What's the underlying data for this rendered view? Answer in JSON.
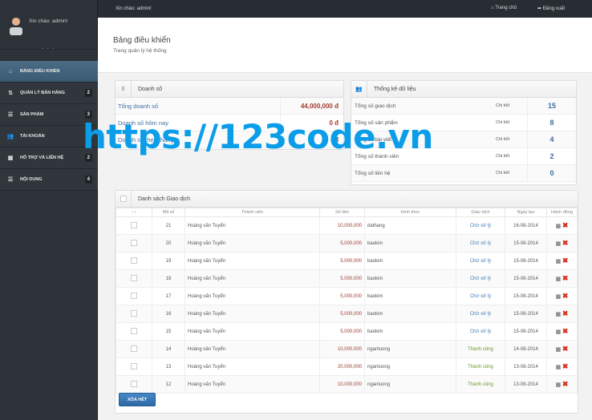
{
  "user": {
    "greeting": "Xin chào: admin!"
  },
  "topbar": {
    "greeting": "Xin chào: admin!",
    "home": "Trang chủ",
    "logout": "Đăng xuất"
  },
  "sidebar": {
    "items": [
      {
        "label": "BẢNG ĐIỀU KHIỂN",
        "icon": "home-icon",
        "badge": null
      },
      {
        "label": "QUẢN LÝ BÁN HÀNG",
        "icon": "sort-icon",
        "badge": "2"
      },
      {
        "label": "SẢN PHẨM",
        "icon": "list-icon",
        "badge": "3"
      },
      {
        "label": "TÀI KHOẢN",
        "icon": "users-icon",
        "badge": null
      },
      {
        "label": "HỖ TRỢ VÀ LIÊN HỆ",
        "icon": "layout-icon",
        "badge": "2"
      },
      {
        "label": "NỘI DUNG",
        "icon": "list-icon",
        "badge": "4"
      }
    ]
  },
  "header": {
    "title": "Bảng điều khiển",
    "subtitle": "Trang quản lý hệ thống"
  },
  "sales": {
    "title": "Doanh số",
    "rows": [
      {
        "label": "Tổng doanh số",
        "value": "44,000,000 đ"
      },
      {
        "label": "Doanh số hôm nay",
        "value": "0 đ"
      },
      {
        "label": "Doanh số theo tháng",
        "value": "đ"
      }
    ]
  },
  "stats": {
    "title": "Thống kê dữ liệu",
    "detail": "Chi tiết",
    "rows": [
      {
        "label": "Tổng số giao dịch",
        "value": "15"
      },
      {
        "label": "Tổng số sản phẩm",
        "value": "8"
      },
      {
        "label": "Tổng số bài viết",
        "value": "4"
      },
      {
        "label": "Tổng số thành viên",
        "value": "2"
      },
      {
        "label": "Tổng số liên hệ",
        "value": "0"
      }
    ]
  },
  "transactions": {
    "title": "Danh sách Giao dịch",
    "columns": [
      "↓↑",
      "Mã số",
      "Thành viên",
      "Số tiền",
      "Hình thức",
      "Giao dịch",
      "Ngày tạo",
      "Hành động"
    ],
    "rows": [
      {
        "id": "21",
        "member": "Hoàng văn Tuyển",
        "amount": "10,000,000",
        "method": "dathang",
        "status": "Chờ xử lý",
        "date": "16-08-2014"
      },
      {
        "id": "20",
        "member": "Hoàng văn Tuyển",
        "amount": "5,000,000",
        "method": "baokim",
        "status": "Chờ xử lý",
        "date": "15-08-2014"
      },
      {
        "id": "19",
        "member": "Hoàng văn Tuyển",
        "amount": "5,000,000",
        "method": "baokim",
        "status": "Chờ xử lý",
        "date": "15-08-2014"
      },
      {
        "id": "18",
        "member": "Hoàng văn Tuyển",
        "amount": "5,000,000",
        "method": "baokim",
        "status": "Chờ xử lý",
        "date": "15-08-2014"
      },
      {
        "id": "17",
        "member": "Hoàng văn Tuyển",
        "amount": "5,000,000",
        "method": "baokim",
        "status": "Chờ xử lý",
        "date": "15-08-2014"
      },
      {
        "id": "16",
        "member": "Hoàng văn Tuyển",
        "amount": "5,000,000",
        "method": "baokim",
        "status": "Chờ xử lý",
        "date": "15-08-2014"
      },
      {
        "id": "15",
        "member": "Hoàng văn Tuyển",
        "amount": "5,000,000",
        "method": "baokim",
        "status": "Chờ xử lý",
        "date": "15-08-2014"
      },
      {
        "id": "14",
        "member": "Hoàng văn Tuyển",
        "amount": "10,000,000",
        "method": "nganluong",
        "status": "Thành công",
        "date": "14-08-2014"
      },
      {
        "id": "13",
        "member": "Hoàng văn Tuyển",
        "amount": "20,000,000",
        "method": "nganluong",
        "status": "Thành công",
        "date": "13-08-2014"
      },
      {
        "id": "12",
        "member": "Hoàng văn Tuyển",
        "amount": "10,000,000",
        "method": "nganluong",
        "status": "Thành công",
        "date": "13-08-2014"
      }
    ],
    "clear_button": "XÓA HẾT"
  },
  "watermark": "https://123code.vn",
  "colors": {
    "sidebar": "#2c3238",
    "active": "#4b6c86",
    "link": "#3f6ea3",
    "money": "#9c3a2e",
    "success": "#6c9b24",
    "button": "#2e6aa5",
    "watermark": "#0b9de8"
  }
}
